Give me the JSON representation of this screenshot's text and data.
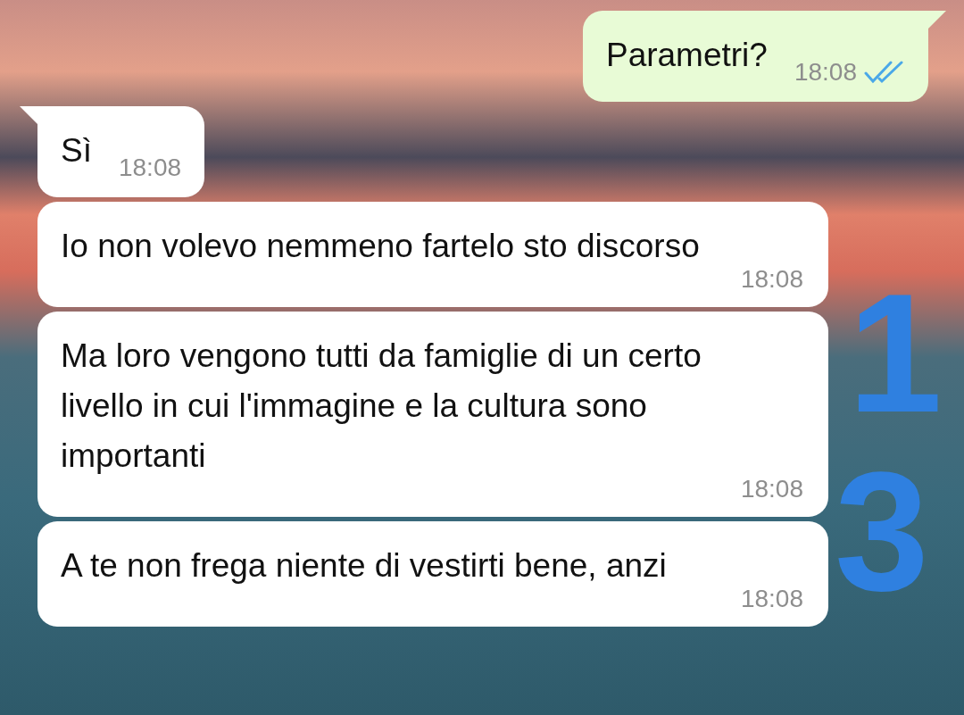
{
  "messages": [
    {
      "kind": "outgoing",
      "text": "Parametri?",
      "time": "18:08",
      "read": true,
      "tail": true
    },
    {
      "kind": "incoming",
      "text": "Sì",
      "time": "18:08",
      "tail": true
    },
    {
      "kind": "incoming",
      "text": "Io non volevo nemmeno fartelo sto discorso",
      "time": "18:08",
      "tail": false
    },
    {
      "kind": "incoming",
      "text": "Ma loro vengono tutti da famiglie di un certo livello in cui l'immagine e la cultura sono importanti",
      "time": "18:08",
      "tail": false
    },
    {
      "kind": "incoming",
      "text": "A te non frega niente di vestirti bene, anzi",
      "time": "18:08",
      "tail": false
    }
  ],
  "handwritten_marks": [
    "1",
    "3"
  ]
}
